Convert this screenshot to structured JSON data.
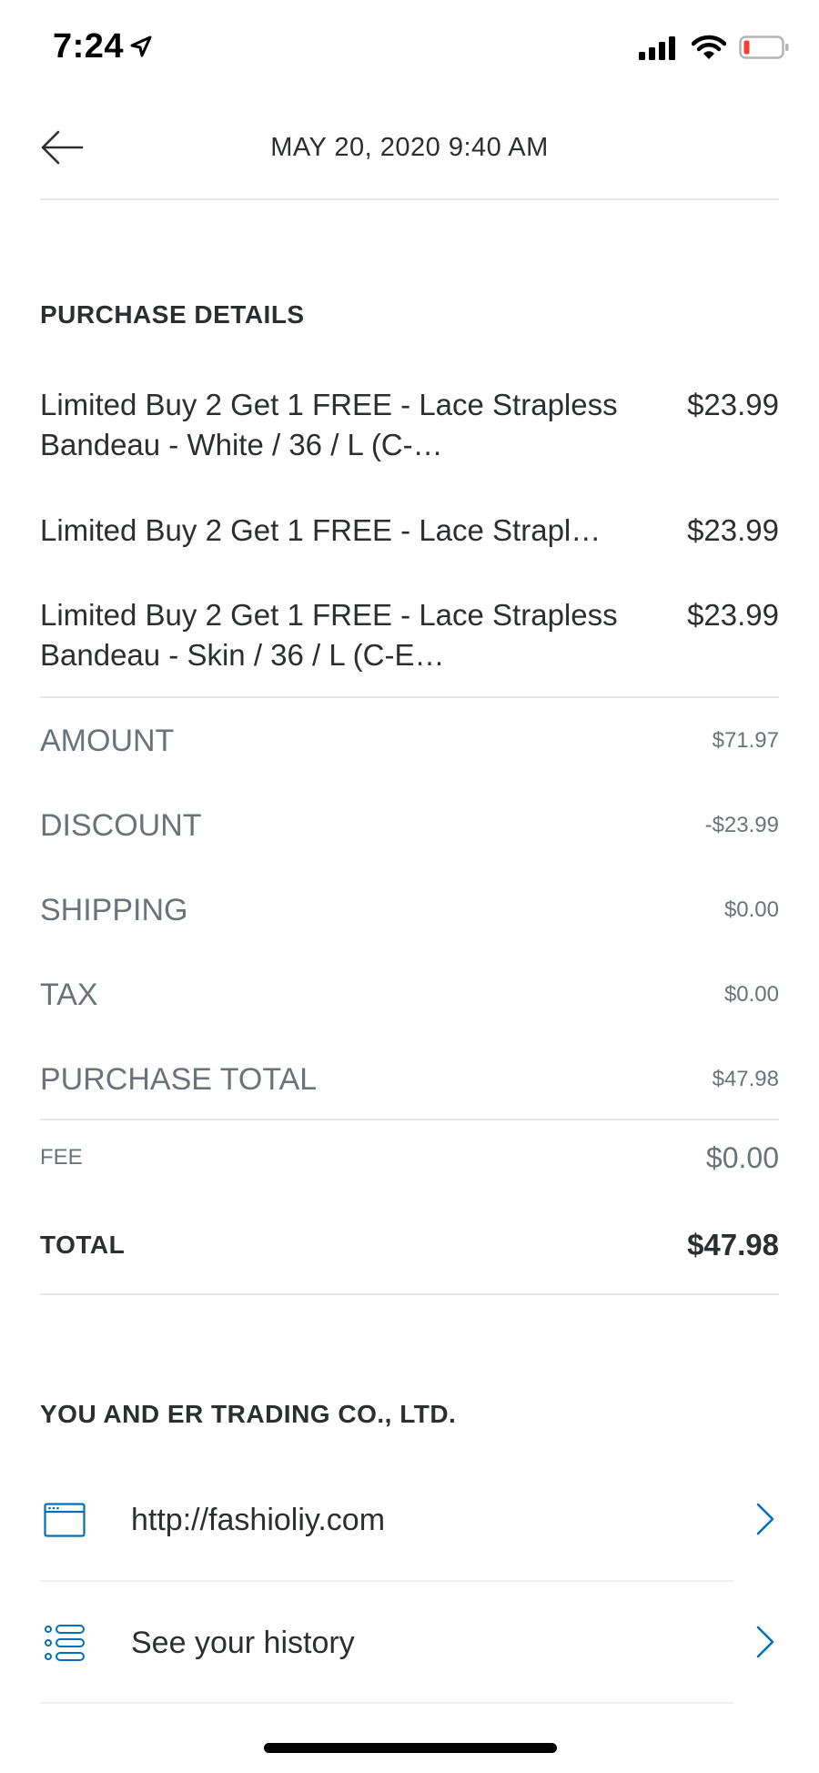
{
  "status_bar": {
    "time": "7:24"
  },
  "nav": {
    "title": "MAY 20, 2020  9:40 AM"
  },
  "purchase": {
    "section_title": "PURCHASE DETAILS",
    "items": [
      {
        "name": "Limited Buy 2 Get 1 FREE - Lace Strapless Bandeau - White / 36 / L  (C-…",
        "price": "$23.99"
      },
      {
        "name": "Limited Buy 2 Get 1 FREE - Lace Strapl…",
        "price": "$23.99"
      },
      {
        "name": "Limited Buy 2 Get 1 FREE - Lace Strapless Bandeau - Skin / 36 / L  (C-E…",
        "price": "$23.99"
      }
    ]
  },
  "summary": {
    "rows": [
      {
        "label": "AMOUNT",
        "value": "$71.97"
      },
      {
        "label": "DISCOUNT",
        "value": "-$23.99"
      },
      {
        "label": "SHIPPING",
        "value": "$0.00"
      },
      {
        "label": "TAX",
        "value": "$0.00"
      },
      {
        "label": "PURCHASE TOTAL",
        "value": "$47.98"
      }
    ],
    "fee_label": "FEE",
    "fee_value": "$0.00",
    "total_label": "TOTAL",
    "total_value": "$47.98"
  },
  "merchant": {
    "section_title": "YOU AND  ER TRADING CO., LTD.",
    "website": "http://fashioliy.com",
    "history_label": "See your history"
  },
  "colors": {
    "accent": "#0070ba",
    "text": "#2c2e2f",
    "muted": "#6c7378"
  },
  "icons": {
    "location": "location-arrow-icon",
    "signal": "cellular-signal-icon",
    "wifi": "wifi-icon",
    "battery": "battery-low-icon",
    "back": "back-arrow-icon",
    "website": "browser-window-icon",
    "history": "list-icon",
    "chevron": "chevron-right-icon"
  }
}
